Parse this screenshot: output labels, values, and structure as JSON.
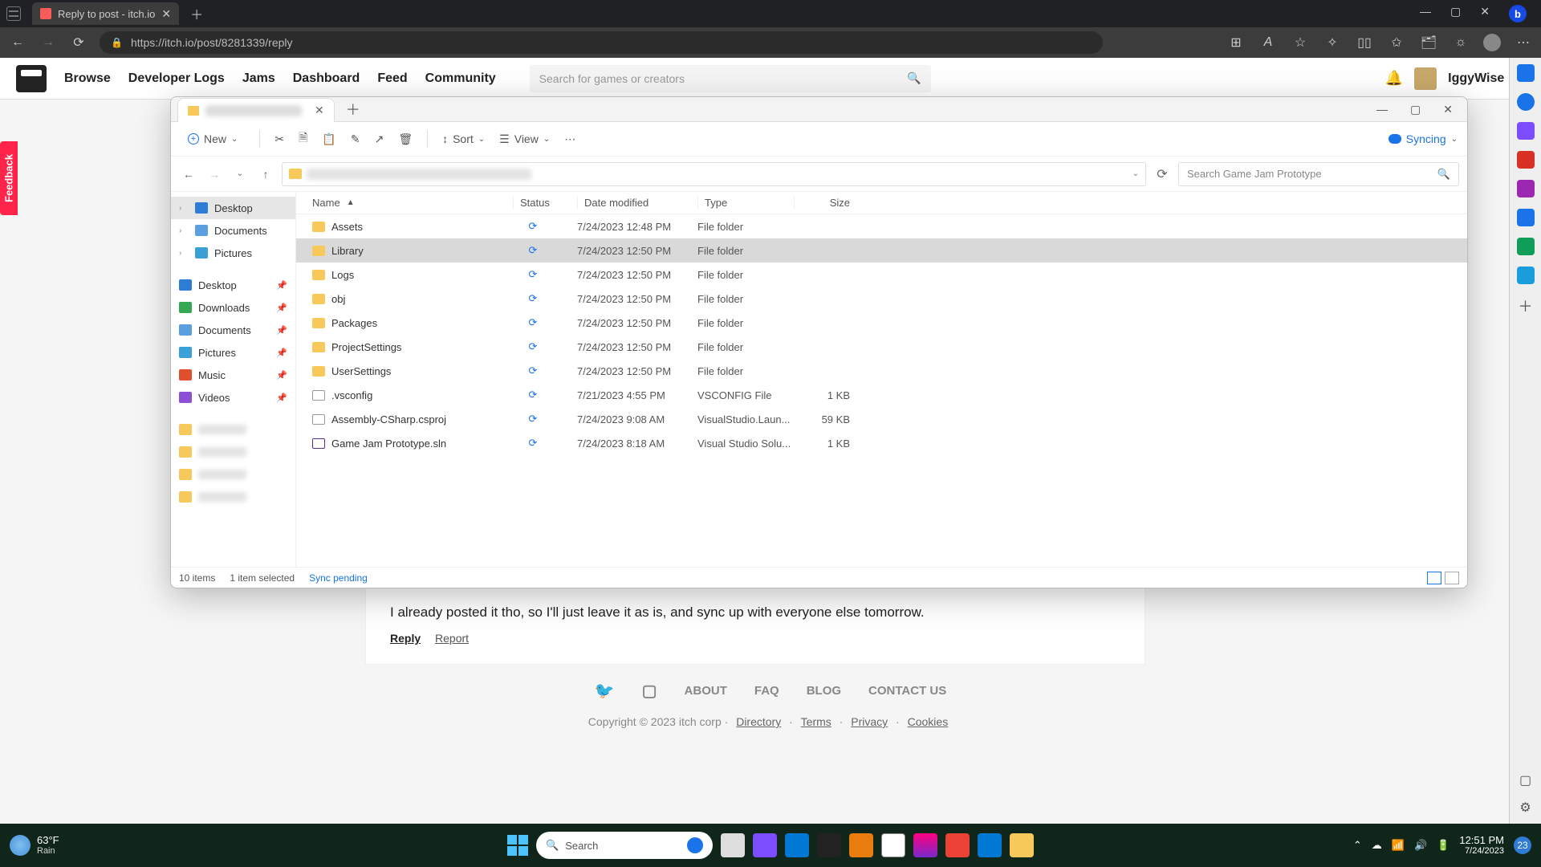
{
  "browser": {
    "tab_title": "Reply to post - itch.io",
    "url": "https://itch.io/post/8281339/reply",
    "window_controls": {
      "min": "—",
      "max": "▢",
      "close": "✕"
    }
  },
  "page": {
    "nav": [
      "Browse",
      "Developer Logs",
      "Jams",
      "Dashboard",
      "Feed",
      "Community"
    ],
    "search_placeholder": "Search for games or creators",
    "username": "IggyWise",
    "feedback": "Feedback",
    "post_text": "I already posted it tho, so I'll just leave it as is, and sync up with everyone else tomorrow.",
    "reply": "Reply",
    "report": "Report",
    "footer_links": [
      "ABOUT",
      "FAQ",
      "BLOG",
      "CONTACT US"
    ],
    "copyright": "Copyright © 2023 itch corp",
    "footer_legal": [
      "Directory",
      "Terms",
      "Privacy",
      "Cookies"
    ]
  },
  "explorer": {
    "toolbar": {
      "new": "New",
      "sort": "Sort",
      "view": "View",
      "syncing": "Syncing"
    },
    "search_placeholder": "Search Game Jam Prototype",
    "columns": {
      "name": "Name",
      "status": "Status",
      "date": "Date modified",
      "type": "Type",
      "size": "Size"
    },
    "nav_quick": [
      {
        "label": "Desktop",
        "ico": "blue"
      },
      {
        "label": "Documents",
        "ico": "doc"
      },
      {
        "label": "Pictures",
        "ico": "pic"
      }
    ],
    "nav_pinned": [
      {
        "label": "Desktop",
        "ico": "desk"
      },
      {
        "label": "Downloads",
        "ico": "dl"
      },
      {
        "label": "Documents",
        "ico": "doc"
      },
      {
        "label": "Pictures",
        "ico": "pic"
      },
      {
        "label": "Music",
        "ico": "mus"
      },
      {
        "label": "Videos",
        "ico": "vid"
      }
    ],
    "files": [
      {
        "name": "Assets",
        "ico": "fold",
        "date": "7/24/2023 12:48 PM",
        "type": "File folder",
        "size": ""
      },
      {
        "name": "Library",
        "ico": "fold",
        "date": "7/24/2023 12:50 PM",
        "type": "File folder",
        "size": "",
        "selected": true
      },
      {
        "name": "Logs",
        "ico": "fold",
        "date": "7/24/2023 12:50 PM",
        "type": "File folder",
        "size": ""
      },
      {
        "name": "obj",
        "ico": "fold",
        "date": "7/24/2023 12:50 PM",
        "type": "File folder",
        "size": ""
      },
      {
        "name": "Packages",
        "ico": "fold",
        "date": "7/24/2023 12:50 PM",
        "type": "File folder",
        "size": ""
      },
      {
        "name": "ProjectSettings",
        "ico": "fold",
        "date": "7/24/2023 12:50 PM",
        "type": "File folder",
        "size": ""
      },
      {
        "name": "UserSettings",
        "ico": "fold",
        "date": "7/24/2023 12:50 PM",
        "type": "File folder",
        "size": ""
      },
      {
        "name": ".vsconfig",
        "ico": "file",
        "date": "7/21/2023 4:55 PM",
        "type": "VSCONFIG File",
        "size": "1 KB"
      },
      {
        "name": "Assembly-CSharp.csproj",
        "ico": "file",
        "date": "7/24/2023 9:08 AM",
        "type": "VisualStudio.Laun...",
        "size": "59 KB"
      },
      {
        "name": "Game Jam Prototype.sln",
        "ico": "sln",
        "date": "7/24/2023 8:18 AM",
        "type": "Visual Studio Solu...",
        "size": "1 KB"
      }
    ],
    "status": {
      "items": "10 items",
      "selected": "1 item selected",
      "sync": "Sync pending"
    }
  },
  "taskbar": {
    "temp": "63°F",
    "cond": "Rain",
    "search_placeholder": "Search",
    "time": "12:51 PM",
    "date": "7/24/2023",
    "badge": "23"
  }
}
